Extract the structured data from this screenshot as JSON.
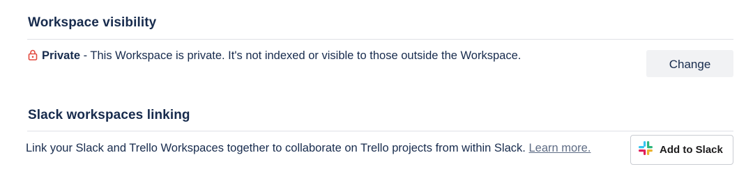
{
  "visibility": {
    "heading": "Workspace visibility",
    "status_label": "Private",
    "description": " - This Workspace is private. It's not indexed or visible to those outside the Workspace.",
    "change_button": "Change",
    "lock_icon": "lock-icon",
    "lock_color": "#e2483d"
  },
  "slack": {
    "heading": "Slack workspaces linking",
    "description": "Link your Slack and Trello Workspaces together to collaborate on Trello projects from within Slack.",
    "learn_more": "Learn more.",
    "add_button": "Add to Slack",
    "slack_icon": "slack-logo-icon"
  }
}
